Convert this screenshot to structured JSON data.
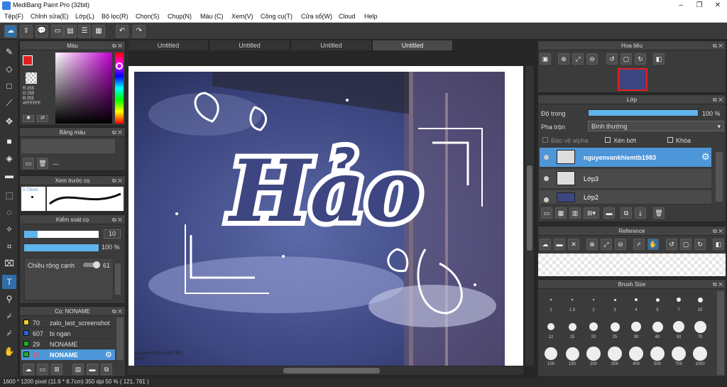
{
  "window": {
    "title": "MediBang Paint Pro (32bit)"
  },
  "menu": [
    "Tệp(F)",
    "Chỉnh sửa(E)",
    "Lớp(L)",
    "Bộ lọc(R)",
    "Chọn(S)",
    "Chụp(N)",
    "Màu (C)",
    "Xem(V)",
    "Công cụ(T)",
    "Cửa sổ(W)",
    "Cloud",
    "Help"
  ],
  "tabs": [
    "Untitled",
    "Untitled",
    "Untitled",
    "Untitled"
  ],
  "color_panel": {
    "title": "Màu",
    "r": "R:255",
    "g": "G:255",
    "b": "B:255",
    "hex": "#FFFFFF"
  },
  "palette_panel": {
    "title": "Bảng màu",
    "empty": "---"
  },
  "brush_preview": {
    "title": "Xem trước cọ",
    "size": "0.73mm"
  },
  "brush_control": {
    "title": "Kiểm soát cọ",
    "size_value": "10",
    "opacity_value": "100 %",
    "width_label": "Chiều rộng cạnh",
    "width_value": "61"
  },
  "brush_list": {
    "title": "Cọ: NONAME",
    "items": [
      {
        "size": "70",
        "name": "zalo_last_screenshot",
        "color": "#f0d020"
      },
      {
        "size": "607",
        "name": "bi ngan",
        "color": "#3060e0"
      },
      {
        "size": "29",
        "name": "NONAME",
        "color": "#20b020"
      },
      {
        "size": "10",
        "name": "NONAME",
        "color": "#20b020"
      }
    ]
  },
  "canvas": {
    "lettering": "Hảo",
    "watermark_line1": "nguyenvankhiemtb1983",
    "watermark_line2": "hd347"
  },
  "navigator": {
    "title": "Hoa tiêu"
  },
  "layer_panel": {
    "title": "Lớp",
    "opacity_label": "Độ trong",
    "opacity_value": "100 %",
    "blend_label": "Pha trộn",
    "blend_value": "Bình thường",
    "protect_alpha": "Bảo vệ alpha",
    "clipping": "Xén bớt",
    "lock": "Khóa",
    "layers": [
      "nguyenvankhiemtb1983",
      "Lớp3",
      "Lớp2"
    ]
  },
  "reference": {
    "title": "Reference"
  },
  "brush_size": {
    "title": "Brush Size",
    "sizes": [
      "1",
      "1.5",
      "2",
      "3",
      "4",
      "5",
      "7",
      "10",
      "12",
      "15",
      "20",
      "25",
      "30",
      "40",
      "50",
      "70",
      "100",
      "150",
      "200",
      "300",
      "400",
      "500",
      "700",
      "1000"
    ]
  },
  "status": {
    "text": "1600 * 1200 pixel    (11.6 * 8.7cm)    350 dpi    50 %    ( 121, 761 )"
  },
  "colors": {
    "accent": "#2f6ea8",
    "selected_layer": "#4d96d8",
    "bar_fill": "#5fb4ec"
  }
}
